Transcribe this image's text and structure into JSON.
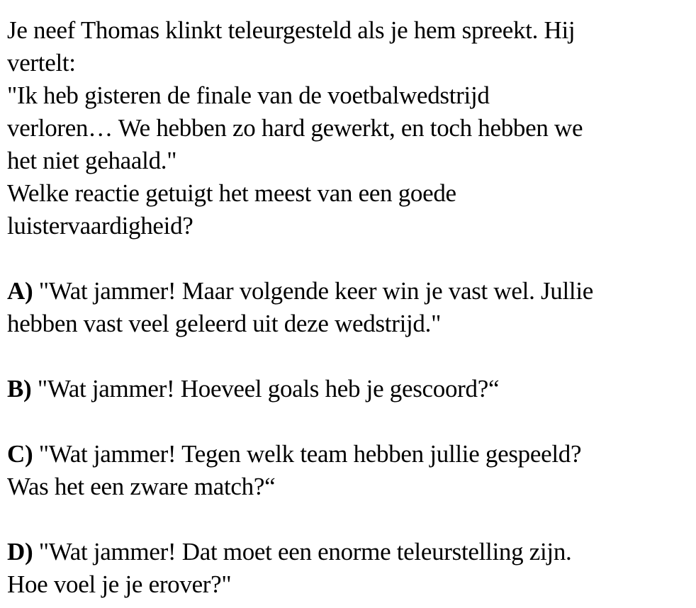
{
  "question": {
    "lines": [
      "Je neef Thomas klinkt teleurgesteld als je hem spreekt. Hij",
      "vertelt:",
      "\"Ik heb gisteren de finale van de voetbalwedstrijd",
      "verloren… We hebben zo hard gewerkt, en toch hebben we",
      "het niet gehaald.\"",
      "Welke reactie getuigt het meest van een goede",
      "luistervaardigheid?"
    ]
  },
  "options": [
    {
      "letter": "A)",
      "lines": [
        "\"Wat jammer! Maar volgende keer win je vast wel. Jullie",
        "hebben vast veel geleerd uit deze wedstrijd.\""
      ]
    },
    {
      "letter": "B)",
      "lines": [
        "\"Wat jammer! Hoeveel goals heb je gescoord?“"
      ]
    },
    {
      "letter": "C)",
      "lines": [
        "\"Wat jammer! Tegen welk team hebben jullie gespeeld?",
        "Was het een zware match?“"
      ]
    },
    {
      "letter": "D)",
      "lines": [
        "\"Wat jammer! Dat moet een enorme teleurstelling zijn.",
        "Hoe voel je je erover?\""
      ]
    }
  ]
}
